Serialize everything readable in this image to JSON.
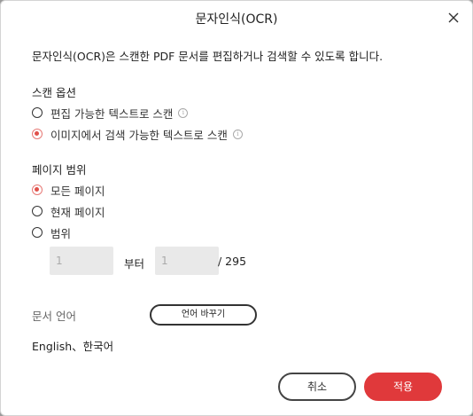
{
  "dialog": {
    "title": "문자인식(OCR)",
    "description": "문자인식(OCR)은 스캔한 PDF 문서를 편집하거나 검색할 수 있도록 합니다."
  },
  "scan_options": {
    "heading": "스캔 옵션",
    "options": [
      {
        "label": "편집 가능한 텍스트로 스캔",
        "checked": false,
        "info_icon": "info-icon"
      },
      {
        "label": "이미지에서 검색 가능한 텍스트로 스캔",
        "checked": true,
        "info_icon": "info-icon"
      }
    ]
  },
  "page_range": {
    "heading": "페이지 범위",
    "options": [
      {
        "label": "모든 페이지",
        "checked": true
      },
      {
        "label": "현재 페이지",
        "checked": false
      },
      {
        "label": "범위",
        "checked": false
      }
    ],
    "from_placeholder": "1",
    "to_word": "부터",
    "to_placeholder": "1",
    "total": "/ 295"
  },
  "language": {
    "label": "문서 언어",
    "change_button": "언어 바꾸기",
    "value": "English、한국어"
  },
  "buttons": {
    "cancel": "취소",
    "apply": "적용"
  },
  "colors": {
    "accent": "#e0393b",
    "radio_checked": "#e0514b"
  }
}
